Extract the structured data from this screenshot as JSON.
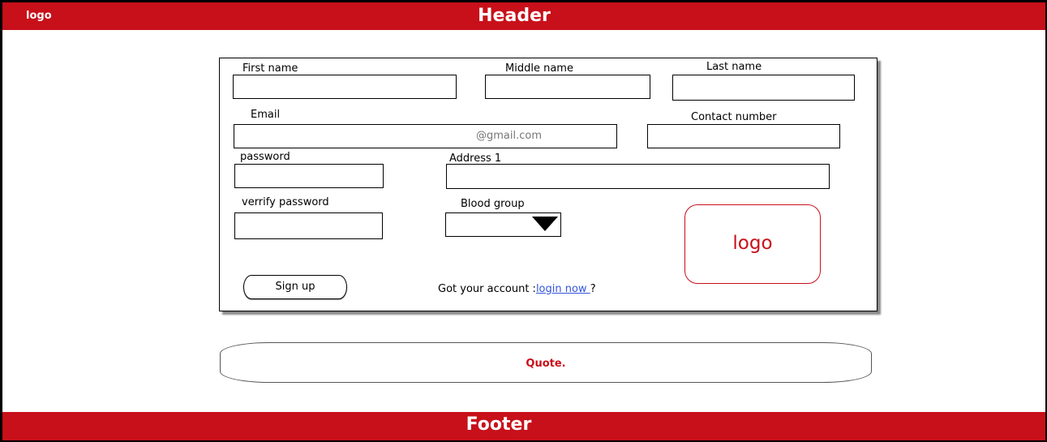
{
  "header": {
    "logo": "logo",
    "title": "Header"
  },
  "form": {
    "first_name_label": "First name",
    "middle_name_label": "Middle name",
    "last_name_label": "Last name",
    "email_label": "Email",
    "email_hint": "@gmail.com",
    "contact_label": "Contact number",
    "password_label": "password",
    "address_label": "Address 1",
    "verify_password_label": "verrify password",
    "blood_group_label": "Blood group",
    "blood_group_icon": "dropdown-arrow-icon",
    "signup_label": "Sign up",
    "account_prompt": "Got your account :",
    "login_link": "login now ",
    "question_mark": "?",
    "logo": "logo"
  },
  "quote": {
    "text": "Quote."
  },
  "footer": {
    "title": "Footer"
  },
  "colors": {
    "brand": "#c8101a",
    "link": "#3355dd"
  }
}
